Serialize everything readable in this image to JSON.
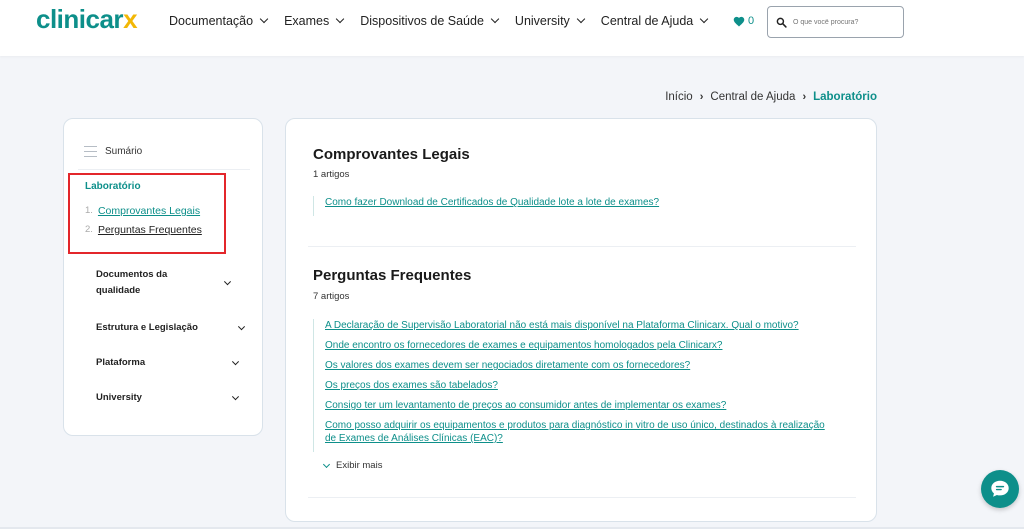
{
  "header": {
    "logo_text": "clinicar",
    "logo_x": "x",
    "nav": [
      {
        "label": "Documentação"
      },
      {
        "label": "Exames"
      },
      {
        "label": "Dispositivos de Saúde"
      },
      {
        "label": "University"
      },
      {
        "label": "Central de Ajuda"
      }
    ],
    "favorites_count": "0",
    "search_placeholder": "O que você procura?"
  },
  "breadcrumb": {
    "home": "Início",
    "parent": "Central de Ajuda",
    "current": "Laboratório"
  },
  "sidebar": {
    "summary_label": "Sumário",
    "active_category": "Laboratório",
    "sub_items": [
      {
        "num": "1.",
        "label": "Comprovantes Legais"
      },
      {
        "num": "2.",
        "label": "Perguntas Frequentes"
      }
    ],
    "sections": [
      {
        "label": "Documentos da qualidade"
      },
      {
        "label": "Estrutura e Legislação"
      },
      {
        "label": "Plataforma"
      },
      {
        "label": "University"
      }
    ]
  },
  "main": {
    "sections": [
      {
        "title": "Comprovantes Legais",
        "count": "1 artigos",
        "articles": [
          "Como fazer Download de Certificados de Qualidade lote a lote de exames?"
        ]
      },
      {
        "title": "Perguntas Frequentes",
        "count": "7 artigos",
        "articles": [
          "A Declaração de Supervisão Laboratorial não está mais disponível na Plataforma Clinicarx. Qual o motivo?",
          "Onde encontro os fornecedores de exames e equipamentos homologados pela Clinicarx?",
          "Os valores dos exames devem ser negociados diretamente com os fornecedores?",
          "Os preços dos exames são tabelados?",
          "Consigo ter um levantamento de preços ao consumidor antes de implementar os exames?",
          "Como posso adquirir os equipamentos e produtos para diagnóstico in vitro de uso único, destinados à realização de Exames de Análises Clínicas (EAC)?"
        ]
      }
    ],
    "show_more": "Exibir mais"
  },
  "colors": {
    "brand": "#0d8f8a",
    "accent": "#f2b705",
    "highlight": "#e3262b"
  }
}
